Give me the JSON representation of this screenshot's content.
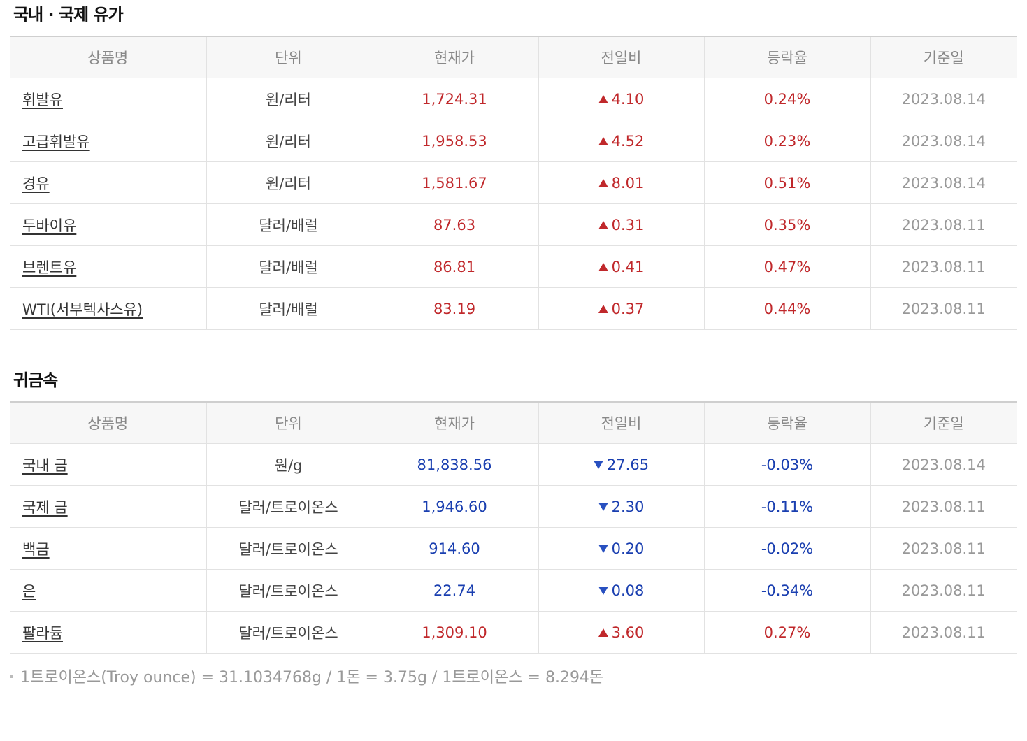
{
  "oil": {
    "title": "국내 · 국제 유가",
    "headers": [
      "상품명",
      "단위",
      "현재가",
      "전일비",
      "등락율",
      "기준일"
    ],
    "rows": [
      {
        "name": "휘발유",
        "unit": "원/리터",
        "price": "1,724.31",
        "change": "4.10",
        "direction": "up",
        "rate": "0.24%",
        "date": "2023.08.14"
      },
      {
        "name": "고급휘발유",
        "unit": "원/리터",
        "price": "1,958.53",
        "change": "4.52",
        "direction": "up",
        "rate": "0.23%",
        "date": "2023.08.14"
      },
      {
        "name": "경유",
        "unit": "원/리터",
        "price": "1,581.67",
        "change": "8.01",
        "direction": "up",
        "rate": "0.51%",
        "date": "2023.08.14"
      },
      {
        "name": "두바이유",
        "unit": "달러/배럴",
        "price": "87.63",
        "change": "0.31",
        "direction": "up",
        "rate": "0.35%",
        "date": "2023.08.11"
      },
      {
        "name": "브렌트유",
        "unit": "달러/배럴",
        "price": "86.81",
        "change": "0.41",
        "direction": "up",
        "rate": "0.47%",
        "date": "2023.08.11"
      },
      {
        "name": "WTI(서부텍사스유)",
        "unit": "달러/배럴",
        "price": "83.19",
        "change": "0.37",
        "direction": "up",
        "rate": "0.44%",
        "date": "2023.08.11"
      }
    ]
  },
  "metal": {
    "title": "귀금속",
    "headers": [
      "상품명",
      "단위",
      "현재가",
      "전일비",
      "등락율",
      "기준일"
    ],
    "rows": [
      {
        "name": "국내 금",
        "unit": "원/g",
        "price": "81,838.56",
        "change": "27.65",
        "direction": "down",
        "rate": "-0.03%",
        "date": "2023.08.14"
      },
      {
        "name": "국제 금",
        "unit": "달러/트로이온스",
        "price": "1,946.60",
        "change": "2.30",
        "direction": "down",
        "rate": "-0.11%",
        "date": "2023.08.11"
      },
      {
        "name": "백금",
        "unit": "달러/트로이온스",
        "price": "914.60",
        "change": "0.20",
        "direction": "down",
        "rate": "-0.02%",
        "date": "2023.08.11"
      },
      {
        "name": "은",
        "unit": "달러/트로이온스",
        "price": "22.74",
        "change": "0.08",
        "direction": "down",
        "rate": "-0.34%",
        "date": "2023.08.11"
      },
      {
        "name": "팔라듐",
        "unit": "달러/트로이온스",
        "price": "1,309.10",
        "change": "3.60",
        "direction": "up",
        "rate": "0.27%",
        "date": "2023.08.11"
      }
    ]
  },
  "footnote": "1트로이온스(Troy ounce) = 31.1034768g /  1돈 = 3.75g /  1트로이온스 = 8.294돈",
  "colors": {
    "up": "#c0282b",
    "down": "#1a3fb0",
    "date": "#999999",
    "header_bg": "#f7f7f7"
  },
  "icons": {
    "up": "triangle-up-icon",
    "down": "triangle-down-icon"
  }
}
